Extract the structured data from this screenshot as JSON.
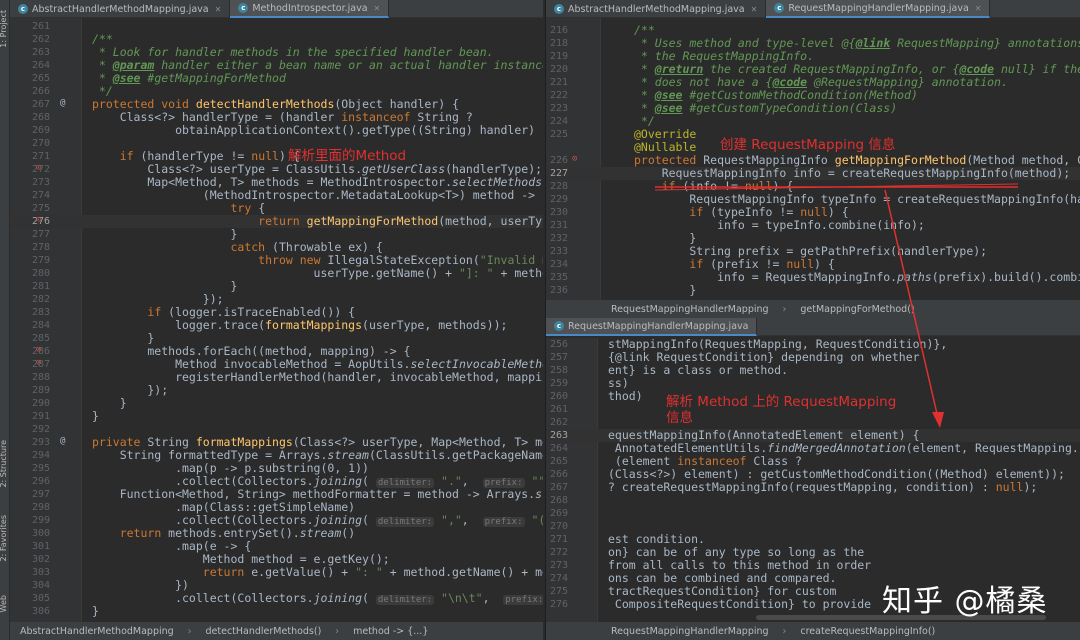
{
  "left_tabs": [
    {
      "label": "AbstractHandlerMethodMapping.java",
      "active": false
    },
    {
      "label": "MethodIntrospector.java",
      "active": true
    }
  ],
  "right_top_tabs": [
    {
      "label": "AbstractHandlerMethodMapping.java",
      "active": false
    },
    {
      "label": "RequestMappingHandlerMapping.java",
      "active": true
    }
  ],
  "right_bottom_tab": "RequestMappingHandlerMapping.java",
  "sidebar_labels": [
    "1: Project",
    "2: Structure",
    "2: Favorites",
    "Web"
  ],
  "left_lines": [
    {
      "n": "261",
      "t": ""
    },
    {
      "n": "262",
      "t": "/**"
    },
    {
      "n": "263",
      "t": " * Look for handler methods in the specified handler bean."
    },
    {
      "n": "264",
      "t": " * @param handler either a bean name or an actual handler instance"
    },
    {
      "n": "265",
      "t": " * @see #getMappingForMethod"
    },
    {
      "n": "266",
      "t": " */"
    },
    {
      "n": "267",
      "t": "protected void detectHandlerMethods(Object handler) {"
    },
    {
      "n": "268",
      "t": "    Class<?> handlerType = (handler instanceof String ?"
    },
    {
      "n": "269",
      "t": "            obtainApplicationContext().getType((String) handler) : handler"
    },
    {
      "n": "270",
      "t": ""
    },
    {
      "n": "271",
      "t": "    if (handlerType != null) {"
    },
    {
      "n": "272",
      "t": "        Class<?> userType = ClassUtils.getUserClass(handlerType);"
    },
    {
      "n": "273",
      "t": "        Map<Method, T> methods = MethodIntrospector.selectMethods(userType,"
    },
    {
      "n": "274",
      "t": "                (MethodIntrospector.MetadataLookup<T>) method -> {"
    },
    {
      "n": "275",
      "t": "                    try {"
    },
    {
      "n": "276",
      "t": "                        return getMappingForMethod(method, userType);"
    },
    {
      "n": "277",
      "t": "                    }"
    },
    {
      "n": "278",
      "t": "                    catch (Throwable ex) {"
    },
    {
      "n": "279",
      "t": "                        throw new IllegalStateException(\"Invalid mapping o"
    },
    {
      "n": "280",
      "t": "                                userType.getName() + \"]: \" + method, ex);"
    },
    {
      "n": "281",
      "t": "                    }"
    },
    {
      "n": "282",
      "t": "                });"
    },
    {
      "n": "283",
      "t": "        if (logger.isTraceEnabled()) {"
    },
    {
      "n": "284",
      "t": "            logger.trace(formatMappings(userType, methods));"
    },
    {
      "n": "285",
      "t": "        }"
    },
    {
      "n": "286",
      "t": "        methods.forEach((method, mapping) -> {"
    },
    {
      "n": "287",
      "t": "            Method invocableMethod = AopUtils.selectInvocableMethod(method"
    },
    {
      "n": "288",
      "t": "            registerHandlerMethod(handler, invocableMethod, mapping);"
    },
    {
      "n": "289",
      "t": "        });"
    },
    {
      "n": "290",
      "t": "    }"
    },
    {
      "n": "291",
      "t": "}"
    },
    {
      "n": "292",
      "t": ""
    },
    {
      "n": "293",
      "t": "private String formatMappings(Class<?> userType, Map<Method, T> methods) {"
    },
    {
      "n": "294",
      "t": "    String formattedType = Arrays.stream(ClassUtils.getPackageName(userTyp"
    },
    {
      "n": "295",
      "t": "            .map(p -> p.substring(0, 1))"
    },
    {
      "n": "296",
      "t": "            .collect(Collectors.joining( delimiter: \".\",  prefix: \"\",  suffix: \"."
    },
    {
      "n": "297",
      "t": "    Function<Method, String> methodFormatter = method -> Arrays.stream(me"
    },
    {
      "n": "298",
      "t": "            .map(Class::getSimpleName)"
    },
    {
      "n": "299",
      "t": "            .collect(Collectors.joining( delimiter: \",\",  prefix: \"(\",  suffix: \")"
    },
    {
      "n": "300",
      "t": "    return methods.entrySet().stream()"
    },
    {
      "n": "301",
      "t": "            .map(e -> {"
    },
    {
      "n": "302",
      "t": "                Method method = e.getKey();"
    },
    {
      "n": "303",
      "t": "                return e.getValue() + \": \" + method.getName() + methodForm"
    },
    {
      "n": "304",
      "t": "            })"
    },
    {
      "n": "305",
      "t": "            .collect(Collectors.joining( delimiter: \"\\n\\t\",  prefix: \"\\n\\t\" +"
    },
    {
      "n": "306",
      "t": "}"
    }
  ],
  "left_breadcrumb": [
    "AbstractHandlerMethodMapping",
    "detectHandlerMethods()",
    "method -> {...}"
  ],
  "right_top_lines": [
    {
      "n": "216",
      "t": "/**"
    },
    {
      "n": "218",
      "t": " * Uses method and type-level @{@link RequestMapping} annotations to crea"
    },
    {
      "n": "219",
      "t": " * the RequestMappingInfo."
    },
    {
      "n": "220",
      "t": " * @return the created RequestMappingInfo, or {@code null} if the method"
    },
    {
      "n": "221",
      "t": " * does not have a {@code @RequestMapping} annotation."
    },
    {
      "n": "222",
      "t": " * @see #getCustomMethodCondition(Method)"
    },
    {
      "n": "223",
      "t": " * @see #getCustomTypeCondition(Class)"
    },
    {
      "n": "224",
      "t": " */"
    },
    {
      "n": "225",
      "t": "@Override"
    },
    {
      "n": "",
      "t": "@Nullable"
    },
    {
      "n": "226",
      "t": "protected RequestMappingInfo getMappingForMethod(Method method, Class<?>"
    },
    {
      "n": "227",
      "t": "    RequestMappingInfo info = createRequestMappingInfo(method);"
    },
    {
      "n": "228",
      "t": "    if (info != null) {"
    },
    {
      "n": "229",
      "t": "        RequestMappingInfo typeInfo = createRequestMappingInfo(handlerTyp"
    },
    {
      "n": "230",
      "t": "        if (typeInfo != null) {"
    },
    {
      "n": "231",
      "t": "            info = typeInfo.combine(info);"
    },
    {
      "n": "232",
      "t": "        }"
    },
    {
      "n": "233",
      "t": "        String prefix = getPathPrefix(handlerType);"
    },
    {
      "n": "234",
      "t": "        if (prefix != null) {"
    },
    {
      "n": "235",
      "t": "            info = RequestMappingInfo.paths(prefix).build().combine(info)"
    },
    {
      "n": "236",
      "t": "        }"
    }
  ],
  "right_top_breadcrumb": [
    "RequestMappingHandlerMapping",
    "getMappingForMethod()"
  ],
  "right_bottom_lines": [
    {
      "n": "256",
      "t": "stMappingInfo(RequestMapping, RequestCondition)},"
    },
    {
      "n": "257",
      "t": "{@link RequestCondition} depending on whether"
    },
    {
      "n": "258",
      "t": "ent} is a class or method."
    },
    {
      "n": "259",
      "t": "ss)"
    },
    {
      "n": "260",
      "t": "thod)"
    },
    {
      "n": "261",
      "t": ""
    },
    {
      "n": "262",
      "t": ""
    },
    {
      "n": "263",
      "t": "equestMappingInfo(AnnotatedElement element) {"
    },
    {
      "n": "264",
      "t": " AnnotatedElementUtils.findMergedAnnotation(element, RequestMapping.class);"
    },
    {
      "n": "265",
      "t": " (element instanceof Class ?"
    },
    {
      "n": "266",
      "t": "(Class<?>) element) : getCustomMethodCondition((Method) element));"
    },
    {
      "n": "267",
      "t": "? createRequestMappingInfo(requestMapping, condition) : null);"
    },
    {
      "n": "268",
      "t": ""
    },
    {
      "n": "269",
      "t": ""
    },
    {
      "n": "270",
      "t": ""
    },
    {
      "n": "271",
      "t": "est condition."
    },
    {
      "n": "272",
      "t": "on} can be of any type so long as the"
    },
    {
      "n": "273",
      "t": "from all calls to this method in order"
    },
    {
      "n": "274",
      "t": "ons can be combined and compared."
    },
    {
      "n": "275",
      "t": "tractRequestCondition} for custom"
    },
    {
      "n": "276",
      "t": " CompositeRequestCondition} to provide"
    }
  ],
  "right_bottom_breadcrumb": [
    "RequestMappingHandlerMapping",
    "createRequestMappingInfo()"
  ],
  "annotations": {
    "a1": "解析里面的Method",
    "a2": "创建 RequestMapping 信息",
    "a3_line1": "解析 Method 上的 RequestMapping",
    "a3_line2": "信息"
  },
  "watermark": "知乎 @橘桑",
  "colors": {
    "annotation": "#e03030",
    "background": "#2b2b2b",
    "keyword": "#cc7832",
    "method_decl": "#ffc66d",
    "javadoc": "#629755",
    "string": "#6a8759"
  }
}
